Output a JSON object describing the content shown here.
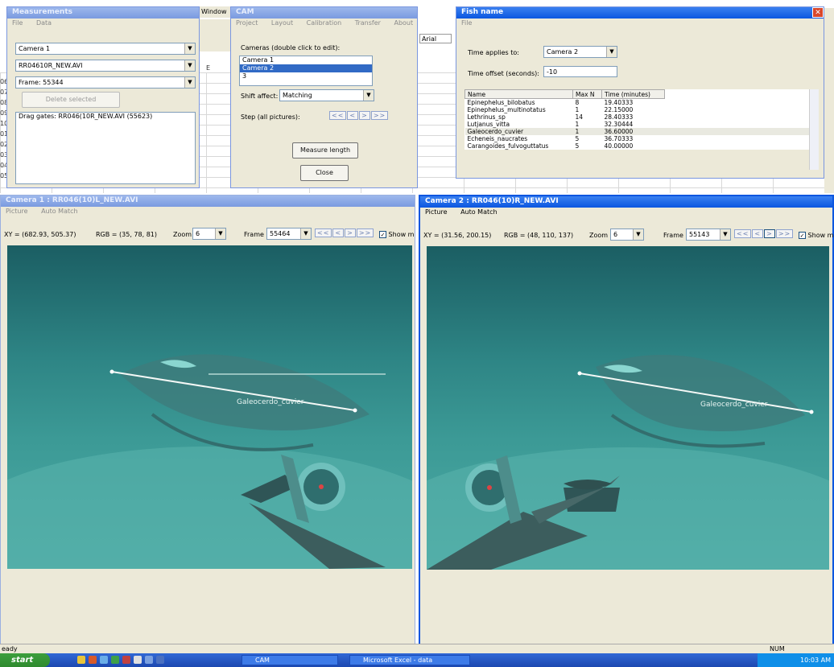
{
  "measurements": {
    "title": "Measurements",
    "menu": [
      "File",
      "Data"
    ],
    "camera_select": "Camera 1",
    "file_select": "RR04610R_NEW.AVI",
    "frame_select": "Frame: 55344",
    "delete_button": "Delete selected",
    "log_entry": "Drag gates: RR046(10R_NEW.AVI (55623)"
  },
  "cam": {
    "title": "CAM",
    "menu": [
      "Project",
      "Layout",
      "Calibration",
      "Transfer",
      "About"
    ],
    "cameras_label": "Cameras (double click to edit):",
    "cameras": [
      "Camera 1",
      "Camera 2",
      "3"
    ],
    "shift_label": "Shift affect:",
    "shift_value": "Matching",
    "step_label": "Step (all pictures):",
    "step_buttons": [
      "<<",
      "<",
      ">",
      ">>"
    ],
    "measure_button": "Measure length",
    "close_button": "Close"
  },
  "fishname": {
    "title": "Fish name",
    "menu": [
      "File"
    ],
    "time_applies_label": "Time applies to:",
    "time_applies_value": "Camera 2",
    "time_offset_label": "Time offset (seconds):",
    "time_offset_value": "-10",
    "columns": [
      "Name",
      "Max N",
      "Time (minutes)"
    ],
    "rows": [
      {
        "name": "Epinephelus_bilobatus",
        "maxn": "8",
        "time": "19.40333"
      },
      {
        "name": "Epinephelus_multinotatus",
        "maxn": "1",
        "time": "22.15000"
      },
      {
        "name": "Lethrinus_sp",
        "maxn": "14",
        "time": "28.40333"
      },
      {
        "name": "Lutjanus_vitta",
        "maxn": "1",
        "time": "32.30444"
      },
      {
        "name": "Galeocerdo_cuvier",
        "maxn": "1",
        "time": "36.60000"
      },
      {
        "name": "Echeneis_naucrates",
        "maxn": "5",
        "time": "36.70333"
      },
      {
        "name": "Carangoides_fulvoguttatus",
        "maxn": "5",
        "time": "40.00000"
      }
    ]
  },
  "excel": {
    "tab_label": "Window",
    "cell_value": "Arial",
    "col_letter": "E",
    "row_numbers": [
      "06",
      "07",
      "08",
      "09",
      "10",
      "01",
      "02",
      "03",
      "04",
      "05"
    ]
  },
  "camera1": {
    "title": "Camera 1 : RR046(10)L_NEW.AVI",
    "menu": [
      "Picture",
      "Auto Match"
    ],
    "coords": "XY = (682.93, 505.37)",
    "rgb": "RGB = (35, 78, 81)",
    "zoom_label": "Zoom",
    "zoom_value": "6",
    "frame_label": "Frame",
    "frame_value": "55464",
    "nav_buttons": [
      "<<",
      "<",
      ">",
      ">>"
    ],
    "show_label": "Show m",
    "fish_label": "Galeocerdo_cuvier"
  },
  "camera2": {
    "title": "Camera 2 : RR046(10)R_NEW.AVI",
    "menu": [
      "Picture",
      "Auto Match"
    ],
    "coords": "XY = (31.56, 200.15)",
    "rgb": "RGB = (48, 110, 137)",
    "zoom_label": "Zoom",
    "zoom_value": "6",
    "frame_label": "Frame",
    "frame_value": "55143",
    "nav_buttons": [
      "<<",
      "<",
      ">",
      ">>"
    ],
    "show_label": "Show m",
    "fish_label": "Galeocerdo_cuvier"
  },
  "status": {
    "ready": "eady",
    "num": "NUM"
  },
  "taskbar": {
    "start": "start",
    "tasks": [
      "CAM",
      "Microsoft Excel - data"
    ],
    "clock": "10:03 AM"
  },
  "colors": {
    "titlebar": "#0b56e0",
    "selection": "#316ac5",
    "water": "#2e8585"
  }
}
